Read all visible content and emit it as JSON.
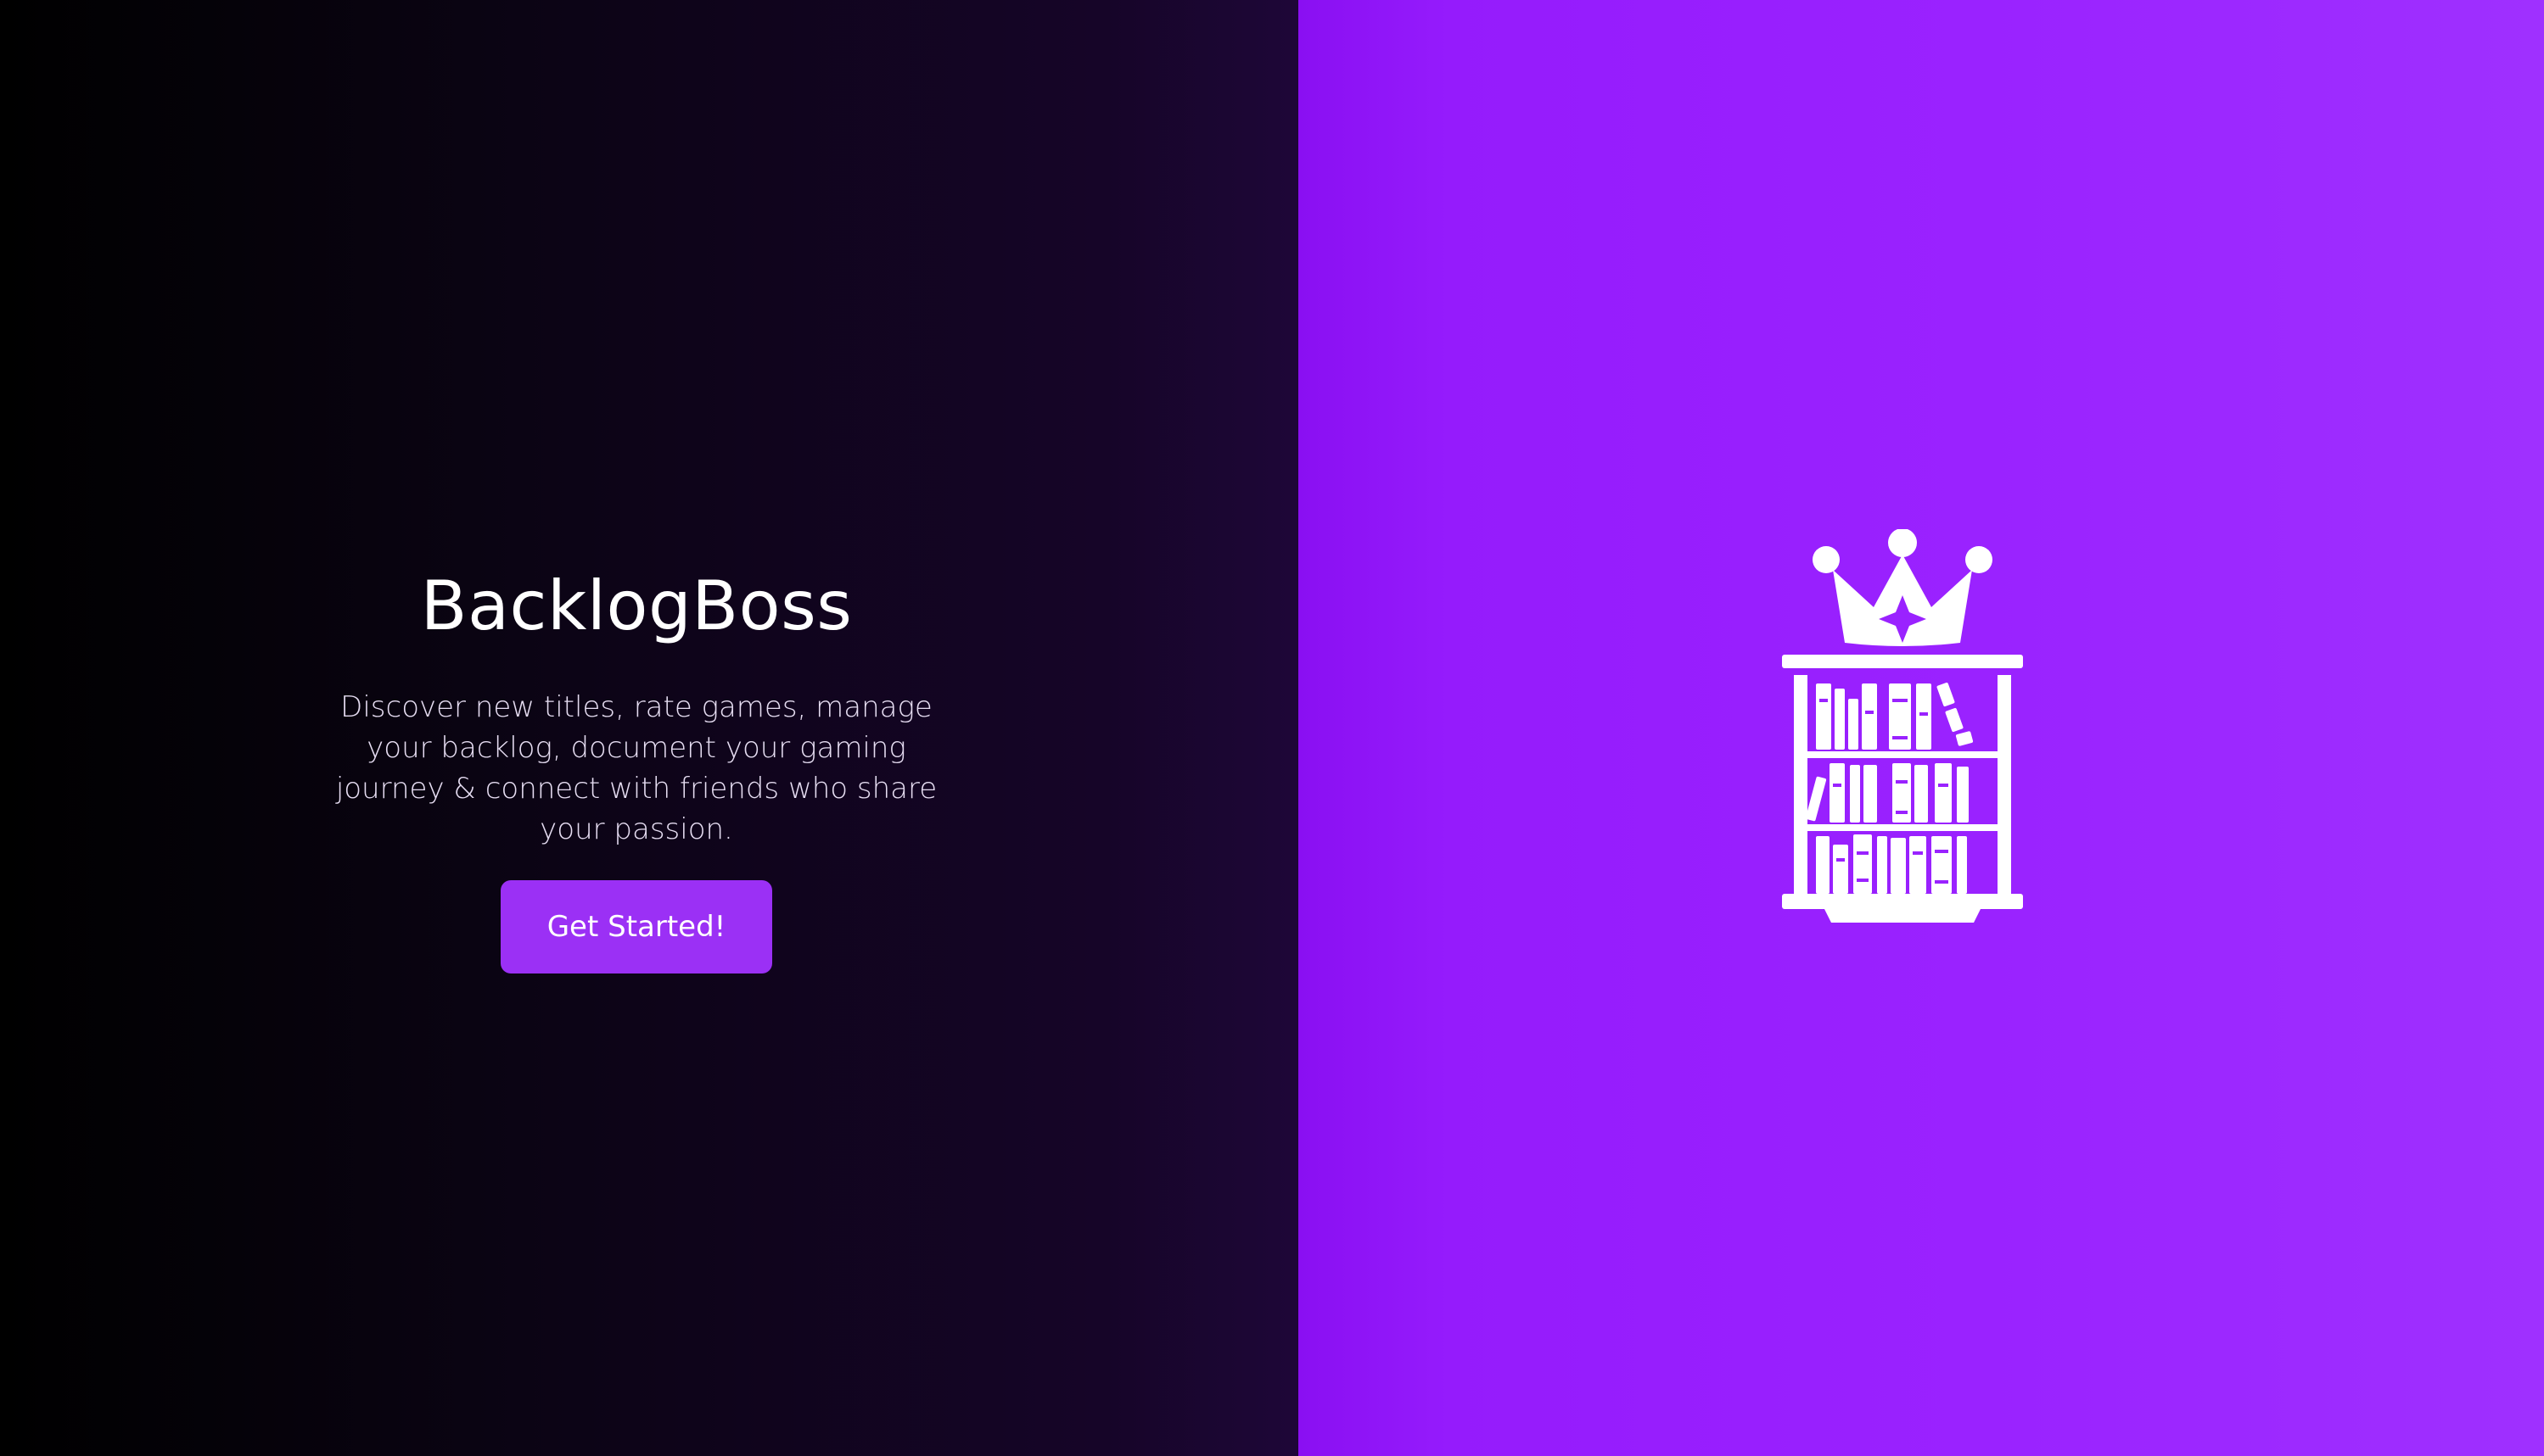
{
  "hero": {
    "title": "BacklogBoss",
    "tagline": "Discover new titles, rate games, manage your backlog, document your gaming journey & connect with friends who share your passion.",
    "cta_label": "Get Started!"
  },
  "illustration": {
    "icon": "crowned-bookshelf-icon"
  },
  "colors": {
    "left_background": "#0b0414",
    "right_background": "#9a22ff",
    "accent": "#9b30f5",
    "text": "#ffffff"
  }
}
